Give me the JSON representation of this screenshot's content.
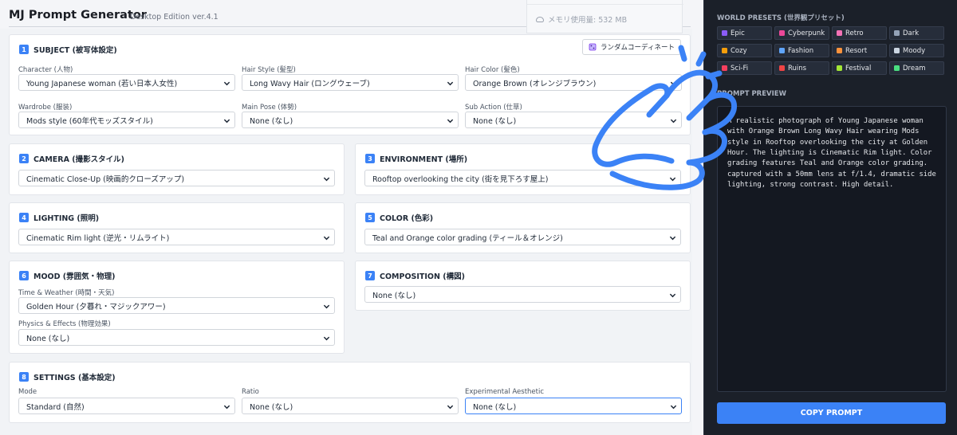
{
  "header": {
    "title": "MJ Prompt Generator",
    "subtitle": "Desktop Edition ver.4.1",
    "memory": "メモリ使用量: 532 MB"
  },
  "subject": {
    "num": "1",
    "title": "SUBJECT (被写体設定)",
    "random_label": "ランダムコーディネート",
    "character_label": "Character (人物)",
    "character_value": "Young Japanese woman (若い日本人女性)",
    "hair_style_label": "Hair Style (髪型)",
    "hair_style_value": "Long Wavy Hair (ロングウェーブ)",
    "hair_color_label": "Hair Color (髪色)",
    "hair_color_value": "Orange Brown (オレンジブラウン)",
    "wardrobe_label": "Wardrobe (服装)",
    "wardrobe_value": "Mods style (60年代モッズスタイル)",
    "main_pose_label": "Main Pose (体勢)",
    "main_pose_value": "None (なし)",
    "sub_action_label": "Sub Action (仕草)",
    "sub_action_value": "None (なし)"
  },
  "camera": {
    "num": "2",
    "title": "CAMERA (撮影スタイル)",
    "value": "Cinematic Close-Up (映画的クローズアップ)"
  },
  "environment": {
    "num": "3",
    "title": "ENVIRONMENT (場所)",
    "value": "Rooftop overlooking the city (街を見下ろす屋上)"
  },
  "lighting": {
    "num": "4",
    "title": "LIGHTING (照明)",
    "value": "Cinematic Rim light (逆光・リムライト)"
  },
  "color": {
    "num": "5",
    "title": "COLOR (色彩)",
    "value": "Teal and Orange color grading (ティール＆オレンジ)"
  },
  "mood": {
    "num": "6",
    "title": "MOOD (雰囲気・物理)",
    "time_label": "Time & Weather (時間・天気)",
    "time_value": "Golden Hour (夕暮れ・マジックアワー)",
    "physics_label": "Physics & Effects (物理効果)",
    "physics_value": "None (なし)"
  },
  "composition": {
    "num": "7",
    "title": "COMPOSITION (構図)",
    "value": "None (なし)"
  },
  "settings": {
    "num": "8",
    "title": "SETTINGS (基本設定)",
    "mode_label": "Mode",
    "mode_value": "Standard (自然)",
    "ratio_label": "Ratio",
    "ratio_value": "None (なし)",
    "exp_label": "Experimental Aesthetic",
    "exp_value": "None (なし)"
  },
  "sidebar": {
    "presets_title": "WORLD PRESETS (世界観プリセット)",
    "presets": [
      {
        "label": "Epic",
        "color": "#8b5cf6"
      },
      {
        "label": "Cyberpunk",
        "color": "#ec4899"
      },
      {
        "label": "Retro",
        "color": "#f472b6"
      },
      {
        "label": "Dark",
        "color": "#94a3b8"
      },
      {
        "label": "Cozy",
        "color": "#f59e0b"
      },
      {
        "label": "Fashion",
        "color": "#60a5fa"
      },
      {
        "label": "Resort",
        "color": "#fb923c"
      },
      {
        "label": "Moody",
        "color": "#cbd5e1"
      },
      {
        "label": "Sci-Fi",
        "color": "#f43f5e"
      },
      {
        "label": "Ruins",
        "color": "#ef4444"
      },
      {
        "label": "Festival",
        "color": "#a3e635"
      },
      {
        "label": "Dream",
        "color": "#4ade80"
      }
    ],
    "preview_title": "PROMPT PREVIEW",
    "preview_text": "A realistic photograph of Young Japanese woman\nwith Orange Brown Long Wavy Hair wearing Mods\nstyle in Rooftop overlooking the city at Golden\nHour. The lighting is Cinematic Rim light. Color\ngrading features Teal and Orange color grading.\ncaptured with a 50mm lens at f/1.4, dramatic side\nlighting, strong contrast. High detail.",
    "copy_label": "COPY PROMPT"
  },
  "colors": {
    "accent": "#3b82f6",
    "sidebar_bg": "#1b2029"
  }
}
